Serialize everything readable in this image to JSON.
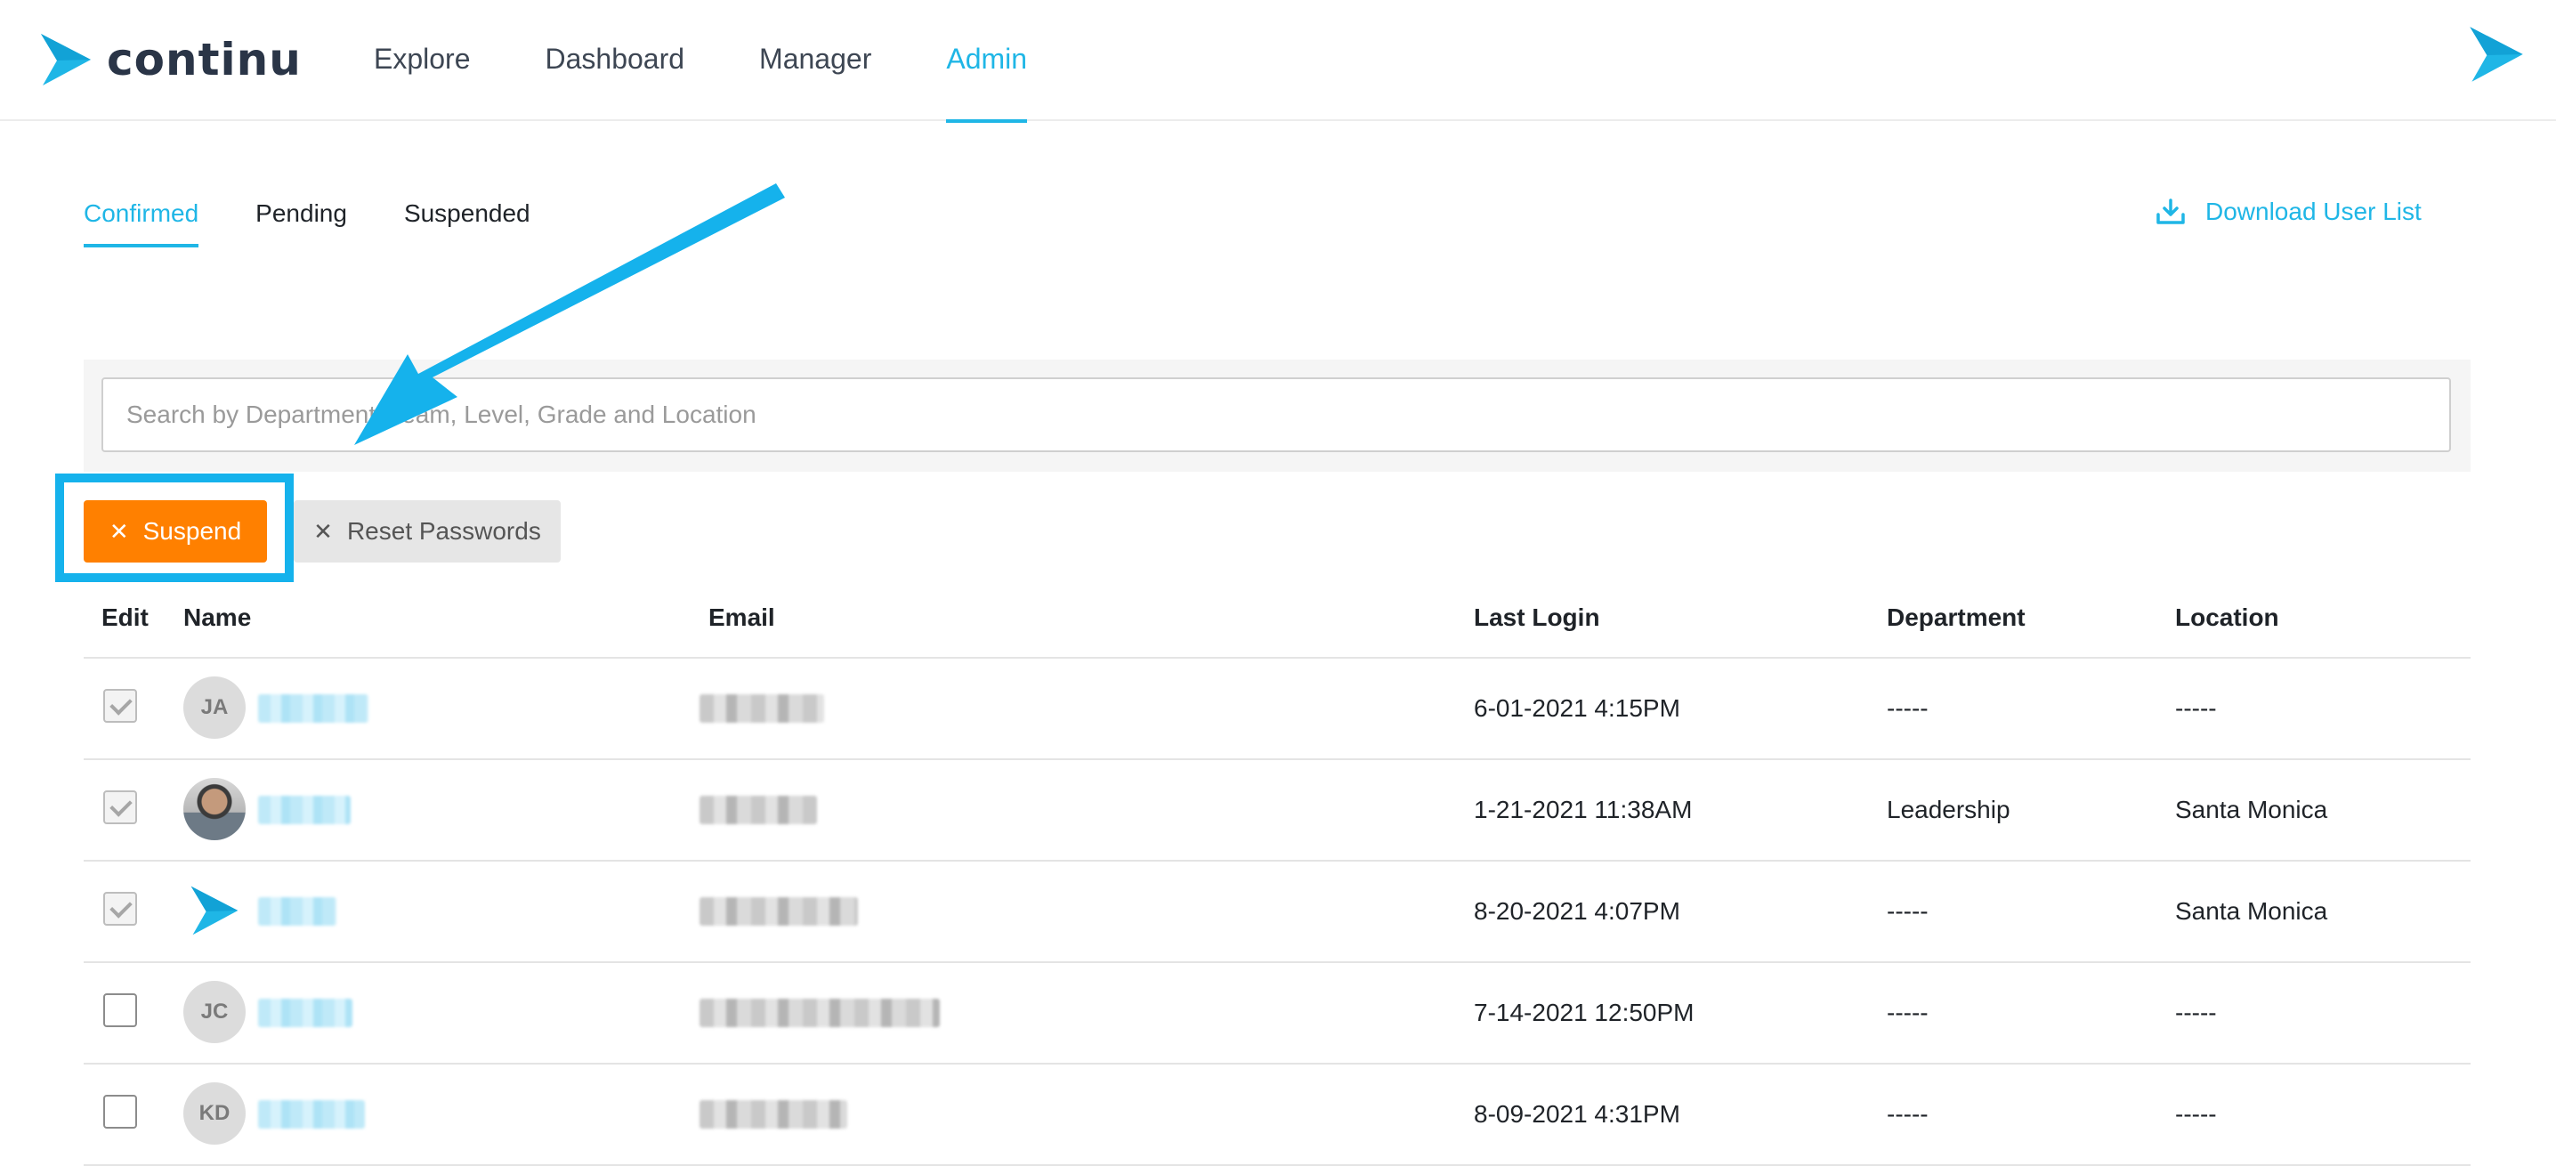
{
  "brand": {
    "name": "continu",
    "accent": "#1fb6e6"
  },
  "nav": {
    "items": [
      {
        "label": "Explore"
      },
      {
        "label": "Dashboard"
      },
      {
        "label": "Manager"
      },
      {
        "label": "Admin"
      }
    ],
    "active": "Admin"
  },
  "subtabs": {
    "items": [
      {
        "label": "Confirmed"
      },
      {
        "label": "Pending"
      },
      {
        "label": "Suspended"
      }
    ],
    "active": "Confirmed"
  },
  "download": {
    "label": "Download User List",
    "icon": "download-icon"
  },
  "search": {
    "placeholder": "Search by Department, Team, Level, Grade and Location",
    "value": ""
  },
  "actions": {
    "suspend_label": "Suspend",
    "suspend_color": "#ff8000",
    "reset_label": "Reset Passwords",
    "icon": "close-icon"
  },
  "annotation": {
    "highlight_color": "#15b2ec",
    "arrow_color": "#15b2ec"
  },
  "table": {
    "columns": {
      "edit": "Edit",
      "name": "Name",
      "email": "Email",
      "last_login": "Last Login",
      "department": "Department",
      "location": "Location"
    },
    "rows": [
      {
        "checked": true,
        "initials": "JA",
        "avatar": "initials",
        "last_login": "6-01-2021 4:15PM",
        "department": "-----",
        "location": "-----"
      },
      {
        "checked": true,
        "initials": "",
        "avatar": "photo",
        "last_login": "1-21-2021 11:38AM",
        "department": "Leadership",
        "location": "Santa Monica"
      },
      {
        "checked": true,
        "initials": "",
        "avatar": "brand",
        "last_login": "8-20-2021 4:07PM",
        "department": "-----",
        "location": "Santa Monica"
      },
      {
        "checked": false,
        "initials": "JC",
        "avatar": "initials",
        "last_login": "7-14-2021 12:50PM",
        "department": "-----",
        "location": "-----"
      },
      {
        "checked": false,
        "initials": "KD",
        "avatar": "initials",
        "last_login": "8-09-2021 4:31PM",
        "department": "-----",
        "location": "-----"
      }
    ]
  }
}
